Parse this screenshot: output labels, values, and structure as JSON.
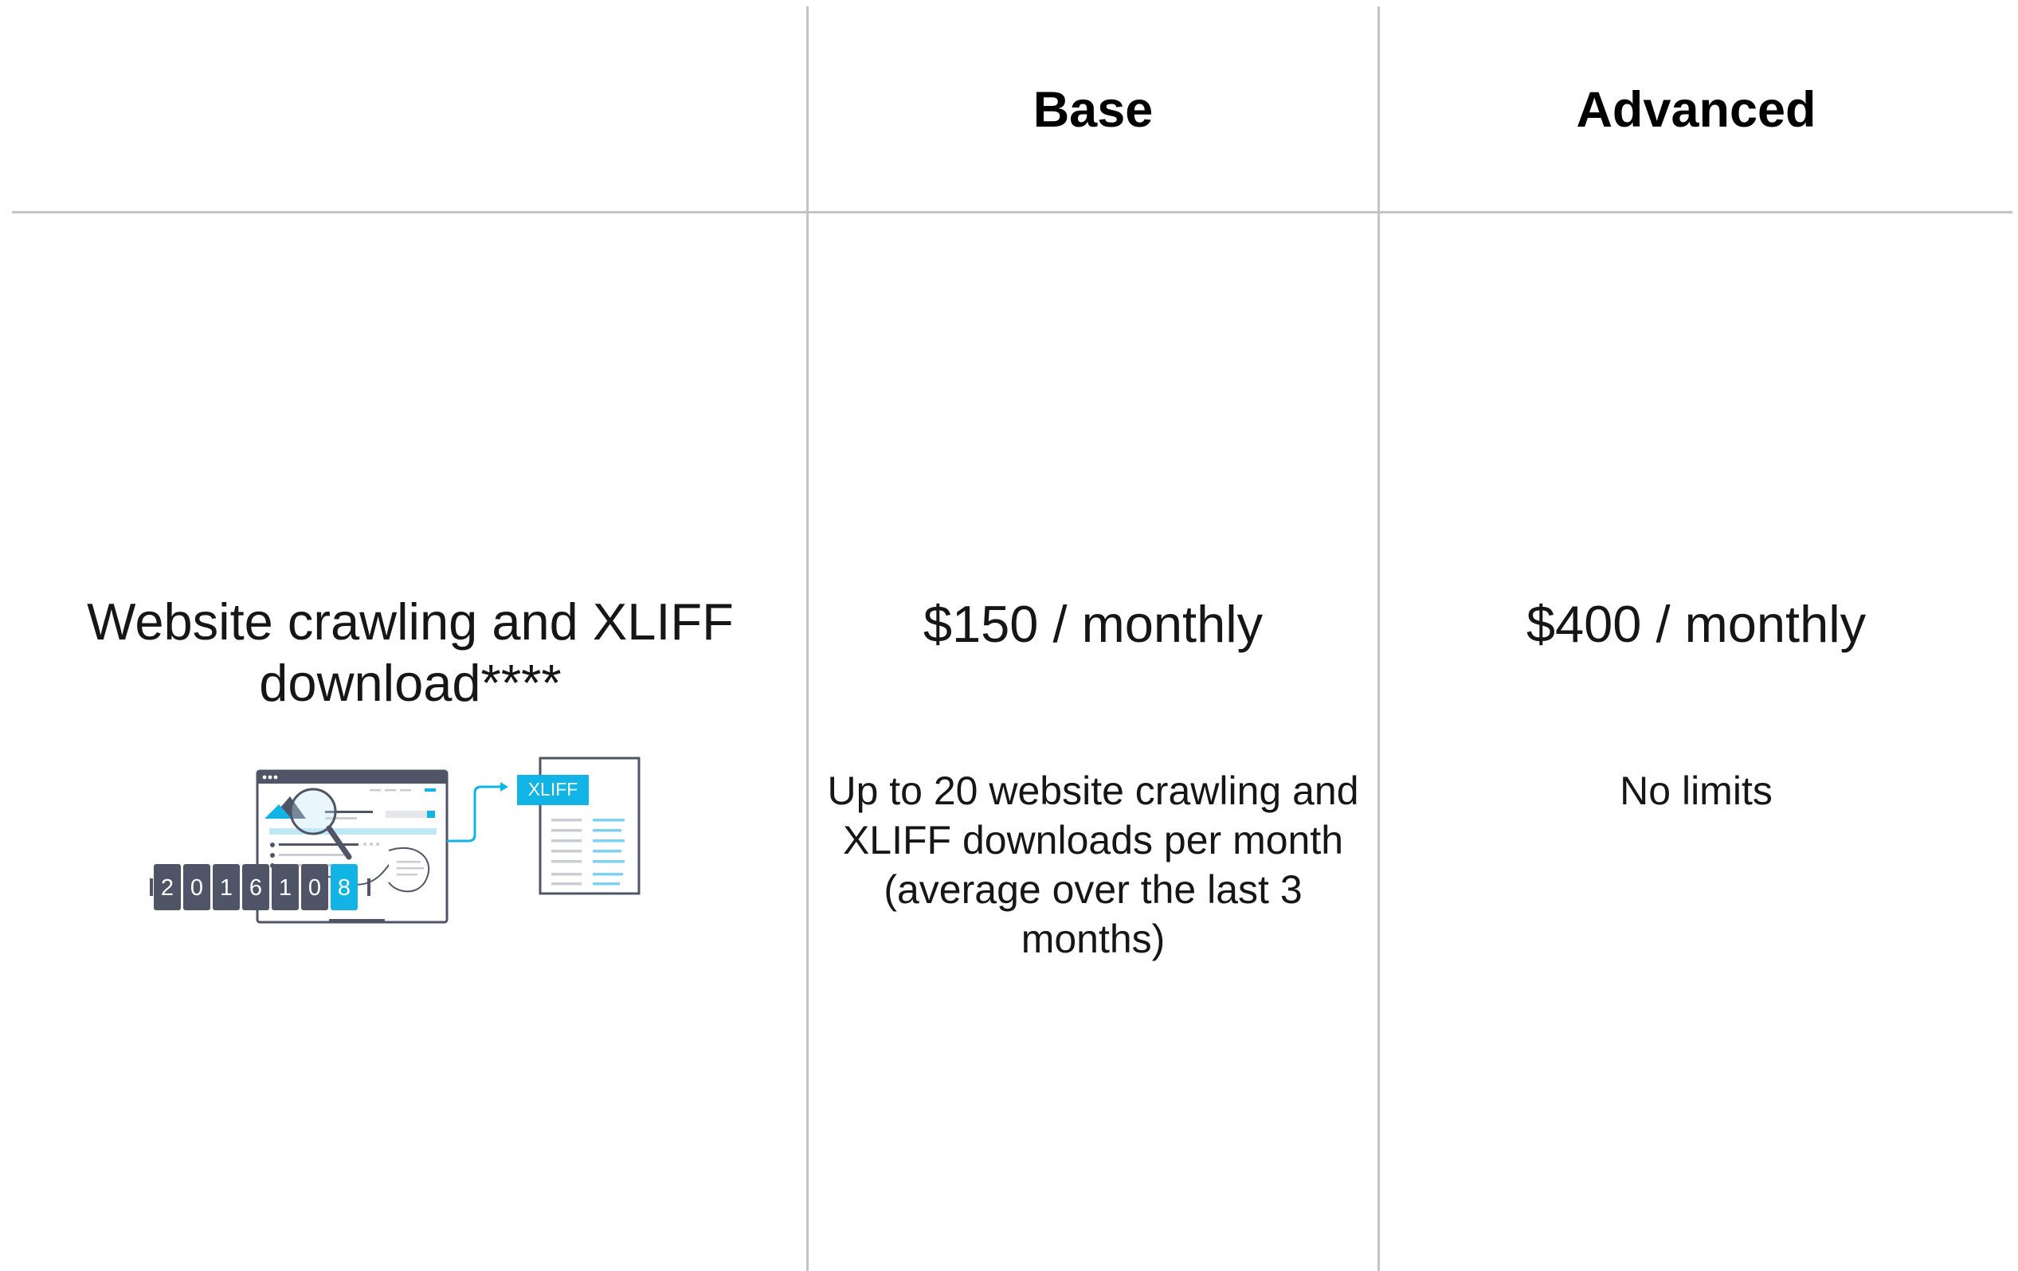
{
  "columns": {
    "base": {
      "title": "Base",
      "price": "$150 / monthly",
      "note": "Up to 20 website crawling and XLIFF downloads per month (average over the last 3 months)"
    },
    "advanced": {
      "title": "Advanced",
      "price": "$400 / monthly",
      "note": "No limits"
    }
  },
  "feature": {
    "title": "Website crawling and XLIFF download****",
    "illustration": {
      "badge": "XLIFF",
      "counter_digits": [
        "2",
        "0",
        "1",
        "6",
        "1",
        "0",
        "8"
      ],
      "accent_color": "#11b4e4",
      "dark_color": "#4f5567"
    }
  }
}
